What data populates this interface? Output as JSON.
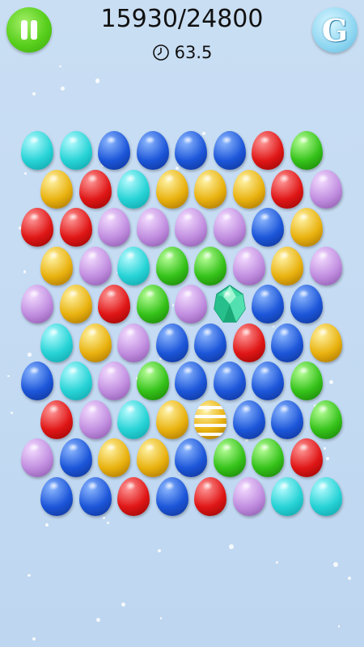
{
  "hud": {
    "score": "15930/24800",
    "timer": "63.5",
    "hint_label": "G",
    "pause_icon": "pause-icon",
    "clock_icon": "clock-icon"
  },
  "colors": {
    "cyan": [
      "#b6fbff",
      "#27d3d6",
      "#0c9ea5"
    ],
    "blue": [
      "#8fb9ff",
      "#1c56d9",
      "#0d2f8f"
    ],
    "red": [
      "#ff9a9a",
      "#e01616",
      "#8f0303"
    ],
    "green": [
      "#b9ff9a",
      "#35c21a",
      "#167a05"
    ],
    "gold": [
      "#fff3a6",
      "#e9b20f",
      "#a06b00"
    ],
    "purple": [
      "#f3dcff",
      "#c18ee0",
      "#8752a8"
    ]
  },
  "board": {
    "rows": [
      [
        "cyan",
        "cyan",
        "blue",
        "blue",
        "blue",
        "blue",
        "red",
        "green"
      ],
      [
        "gold",
        "red",
        "cyan",
        "gold",
        "gold",
        "gold",
        "red",
        "purple"
      ],
      [
        "red",
        "red",
        "purple",
        "purple",
        "purple",
        "purple",
        "blue",
        "gold"
      ],
      [
        "gold",
        "purple",
        "cyan",
        "green",
        "green",
        "purple",
        "gold",
        "purple"
      ],
      [
        "purple",
        "gold",
        "red",
        "green",
        "purple",
        "diamond",
        "blue",
        "blue"
      ],
      [
        "cyan",
        "gold",
        "purple",
        "blue",
        "blue",
        "red",
        "blue",
        "gold"
      ],
      [
        "blue",
        "cyan",
        "purple",
        "green",
        "blue",
        "blue",
        "blue",
        "green"
      ],
      [
        "red",
        "purple",
        "cyan",
        "gold",
        "striped",
        "blue",
        "blue",
        "green"
      ],
      [
        "purple",
        "blue",
        "gold",
        "gold",
        "blue",
        "green",
        "green",
        "red"
      ],
      [
        "blue",
        "blue",
        "red",
        "blue",
        "red",
        "purple",
        "cyan",
        "cyan"
      ]
    ],
    "special": {
      "diamond": "diamond-gem",
      "striped": "striped-egg"
    }
  }
}
